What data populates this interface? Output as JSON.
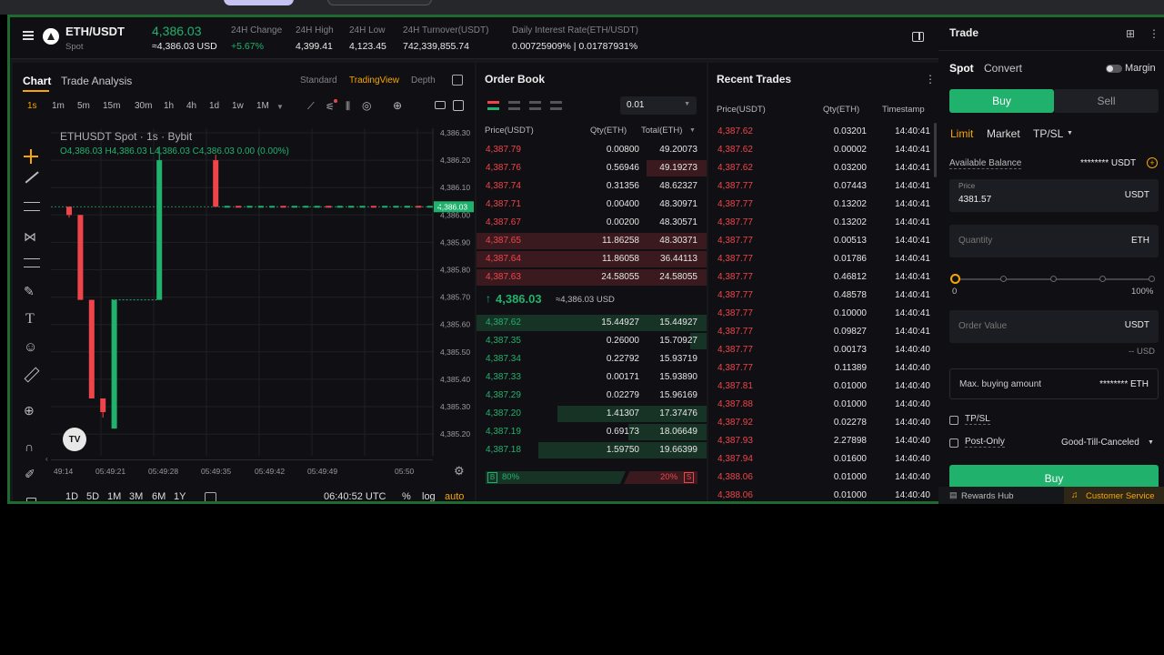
{
  "ticker": {
    "pair": "ETH/USDT",
    "market_type": "Spot",
    "last_price": "4,386.03",
    "last_price_usd": "≈4,386.03 USD",
    "change_label": "24H Change",
    "change_value": "+5.67%",
    "high_label": "24H High",
    "high_value": "4,399.41",
    "low_label": "24H Low",
    "low_value": "4,123.45",
    "turnover_label": "24H Turnover(USDT)",
    "turnover_value": "742,339,855.74",
    "interest_label": "Daily Interest Rate(ETH/USDT)",
    "interest_value": "0.00725909% | 0.01787931%"
  },
  "chart": {
    "tabs": [
      "Chart",
      "Trade Analysis"
    ],
    "views": [
      "Standard",
      "TradingView",
      "Depth"
    ],
    "intervals": [
      "1s",
      "1m",
      "5m",
      "15m",
      "30m",
      "1h",
      "4h",
      "1d",
      "1w",
      "1M"
    ],
    "title": "ETHUSDT Spot · 1s · Bybit",
    "ohlc": "O4,386.03  H4,386.03  L4,386.03  C4,386.03  0.00 (0.00%)",
    "price_ticks": [
      "4,386.30",
      "4,386.20",
      "4,386.10",
      "4,386.00",
      "4,385.90",
      "4,385.80",
      "4,385.70",
      "4,385.60",
      "4,385.50",
      "4,385.40",
      "4,385.30",
      "4,385.20"
    ],
    "current_tag": "4,386.03",
    "time_ticks": [
      "49:14",
      "05:49:21",
      "05:49:28",
      "05:49:35",
      "05:49:42",
      "05:49:49",
      "05:50"
    ],
    "ranges": [
      "1D",
      "5D",
      "1M",
      "3M",
      "6M",
      "1Y"
    ],
    "clock": "06:40:52 UTC",
    "percent": "%",
    "log": "log",
    "auto": "auto",
    "logo": "TV"
  },
  "chart_data": {
    "type": "candlestick",
    "interval": "1s",
    "ylim": [
      4385.15,
      4386.35
    ],
    "candles": [
      {
        "x": 1,
        "open": 4386.03,
        "close": 4386.0,
        "high": 4386.03,
        "low": 4385.99
      },
      {
        "x": 2,
        "open": 4386.0,
        "close": 4385.69,
        "high": 4386.0,
        "low": 4385.69
      },
      {
        "x": 3,
        "open": 4385.69,
        "close": 4385.33,
        "high": 4385.69,
        "low": 4385.33
      },
      {
        "x": 4,
        "open": 4385.33,
        "close": 4385.28,
        "high": 4385.33,
        "low": 4385.26
      },
      {
        "x": 5,
        "open": 4385.22,
        "close": 4385.69,
        "high": 4385.69,
        "low": 4385.22
      },
      {
        "x": 9,
        "open": 4385.69,
        "close": 4386.2,
        "high": 4386.25,
        "low": 4385.69
      },
      {
        "x": 14,
        "open": 4386.2,
        "close": 4386.03,
        "high": 4386.22,
        "low": 4386.03
      }
    ]
  },
  "order_book": {
    "title": "Order Book",
    "precision": "0.01",
    "headers": [
      "Price(USDT)",
      "Qty(ETH)",
      "Total(ETH)"
    ],
    "asks": [
      {
        "price": "4,387.79",
        "qty": "0.00800",
        "total": "49.20073",
        "depth": 0.0
      },
      {
        "price": "4,387.76",
        "qty": "0.56946",
        "total": "49.19273",
        "depth": 0.26
      },
      {
        "price": "4,387.74",
        "qty": "0.31356",
        "total": "48.62327",
        "depth": 0.0
      },
      {
        "price": "4,387.71",
        "qty": "0.00400",
        "total": "48.30971",
        "depth": 0.0
      },
      {
        "price": "4,387.67",
        "qty": "0.00200",
        "total": "48.30571",
        "depth": 0.0
      },
      {
        "price": "4,387.65",
        "qty": "11.86258",
        "total": "48.30371",
        "depth": 1.0
      },
      {
        "price": "4,387.64",
        "qty": "11.86058",
        "total": "36.44113",
        "depth": 1.0
      },
      {
        "price": "4,387.63",
        "qty": "24.58055",
        "total": "24.58055",
        "depth": 1.0
      }
    ],
    "mid_price": "4,386.03",
    "mid_usd": "≈4,386.03 USD",
    "bids": [
      {
        "price": "4,387.62",
        "qty": "15.44927",
        "total": "15.44927",
        "depth": 1.0
      },
      {
        "price": "4,387.35",
        "qty": "0.26000",
        "total": "15.70927",
        "depth": 0.07
      },
      {
        "price": "4,387.34",
        "qty": "0.22792",
        "total": "15.93719",
        "depth": 0.0
      },
      {
        "price": "4,387.33",
        "qty": "0.00171",
        "total": "15.93890",
        "depth": 0.0
      },
      {
        "price": "4,387.29",
        "qty": "0.02279",
        "total": "15.96169",
        "depth": 0.0
      },
      {
        "price": "4,387.20",
        "qty": "1.41307",
        "total": "17.37476",
        "depth": 0.65
      },
      {
        "price": "4,387.19",
        "qty": "0.69173",
        "total": "18.06649",
        "depth": 0.34
      },
      {
        "price": "4,387.18",
        "qty": "1.59750",
        "total": "19.66399",
        "depth": 0.73
      }
    ],
    "buy_tag": "B",
    "buy_pct": "80%",
    "sell_pct": "20%",
    "sell_tag": "S"
  },
  "recent_trades": {
    "title": "Recent Trades",
    "headers": [
      "Price(USDT)",
      "Qty(ETH)",
      "Timestamp"
    ],
    "rows": [
      {
        "price": "4,387.62",
        "qty": "0.03201",
        "time": "14:40:41"
      },
      {
        "price": "4,387.62",
        "qty": "0.00002",
        "time": "14:40:41"
      },
      {
        "price": "4,387.62",
        "qty": "0.03200",
        "time": "14:40:41"
      },
      {
        "price": "4,387.77",
        "qty": "0.07443",
        "time": "14:40:41"
      },
      {
        "price": "4,387.77",
        "qty": "0.13202",
        "time": "14:40:41"
      },
      {
        "price": "4,387.77",
        "qty": "0.13202",
        "time": "14:40:41"
      },
      {
        "price": "4,387.77",
        "qty": "0.00513",
        "time": "14:40:41"
      },
      {
        "price": "4,387.77",
        "qty": "0.01786",
        "time": "14:40:41"
      },
      {
        "price": "4,387.77",
        "qty": "0.46812",
        "time": "14:40:41"
      },
      {
        "price": "4,387.77",
        "qty": "0.48578",
        "time": "14:40:41"
      },
      {
        "price": "4,387.77",
        "qty": "0.10000",
        "time": "14:40:41"
      },
      {
        "price": "4,387.77",
        "qty": "0.09827",
        "time": "14:40:41"
      },
      {
        "price": "4,387.77",
        "qty": "0.00173",
        "time": "14:40:40"
      },
      {
        "price": "4,387.77",
        "qty": "0.11389",
        "time": "14:40:40"
      },
      {
        "price": "4,387.81",
        "qty": "0.01000",
        "time": "14:40:40"
      },
      {
        "price": "4,387.88",
        "qty": "0.01000",
        "time": "14:40:40"
      },
      {
        "price": "4,387.92",
        "qty": "0.02278",
        "time": "14:40:40"
      },
      {
        "price": "4,387.93",
        "qty": "2.27898",
        "time": "14:40:40"
      },
      {
        "price": "4,387.94",
        "qty": "0.01600",
        "time": "14:40:40"
      },
      {
        "price": "4,388.06",
        "qty": "0.01000",
        "time": "14:40:40"
      },
      {
        "price": "4,388.06",
        "qty": "0.01000",
        "time": "14:40:40"
      }
    ]
  },
  "trade": {
    "title": "Trade",
    "tabs": [
      "Spot",
      "Convert"
    ],
    "margin_label": "Margin",
    "buy_tab": "Buy",
    "sell_tab": "Sell",
    "order_types": [
      "Limit",
      "Market",
      "TP/SL"
    ],
    "balance_label": "Available Balance",
    "balance_value": "******** USDT",
    "price_caption": "Price",
    "price_value": "4381.57",
    "price_unit": "USDT",
    "qty_placeholder": "Quantity",
    "qty_unit": "ETH",
    "slider_min": "0",
    "slider_max": "100%",
    "slider_value": 0,
    "order_value_placeholder": "Order Value",
    "order_value_unit": "USDT",
    "order_value_usd": "-- USD",
    "max_buy_label": "Max. buying amount",
    "max_buy_value": "******** ETH",
    "tpsl_label": "TP/SL",
    "postonly_label": "Post-Only",
    "tif_value": "Good-Till-Canceled",
    "buy_button": "Buy",
    "rewards": "Rewards Hub",
    "support": "Customer Service"
  },
  "colors": {
    "up": "#20b26c",
    "down": "#ef454a",
    "accent": "#f7a600",
    "frame": "#1e6a30"
  }
}
